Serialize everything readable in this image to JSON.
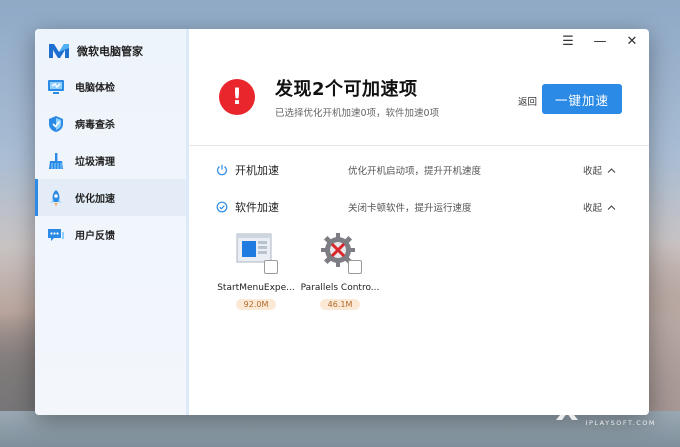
{
  "app": {
    "title": "微软电脑管家"
  },
  "sidebar": {
    "items": [
      {
        "label": "电脑体检",
        "icon": "monitor-check-icon",
        "active": false
      },
      {
        "label": "病毒查杀",
        "icon": "shield-icon",
        "active": false
      },
      {
        "label": "垃圾清理",
        "icon": "broom-icon",
        "active": false
      },
      {
        "label": "优化加速",
        "icon": "rocket-icon",
        "active": true
      },
      {
        "label": "用户反馈",
        "icon": "feedback-icon",
        "active": false
      }
    ]
  },
  "window_controls": {
    "menu": "☰",
    "minimize": "—",
    "close": "✕"
  },
  "header": {
    "alert_symbol": "!",
    "headline": "发现2个可加速项",
    "subline": "已选择优化开机加速0项，软件加速0项",
    "back_label": "返回",
    "primary_button": "一键加速"
  },
  "sections": [
    {
      "title": "开机加速",
      "description": "优化开机启动项，提升开机速度",
      "collapse_label": "收起",
      "icon": "power-icon"
    },
    {
      "title": "软件加速",
      "description": "关闭卡顿软件，提升运行速度",
      "collapse_label": "收起",
      "icon": "clock-check-icon"
    }
  ],
  "apps": [
    {
      "name": "StartMenuExpe...",
      "size": "92.0M",
      "icon": "window-app-icon"
    },
    {
      "name": "Parallels Contro...",
      "size": "46.1M",
      "icon": "parallels-gear-icon"
    }
  ],
  "colors": {
    "accent": "#2a8ae6",
    "alert": "#e8262b",
    "size_badge_bg": "#fbe9d6"
  },
  "watermark": {
    "cn": "异次元",
    "en": "IPLAYSOFT.COM"
  }
}
